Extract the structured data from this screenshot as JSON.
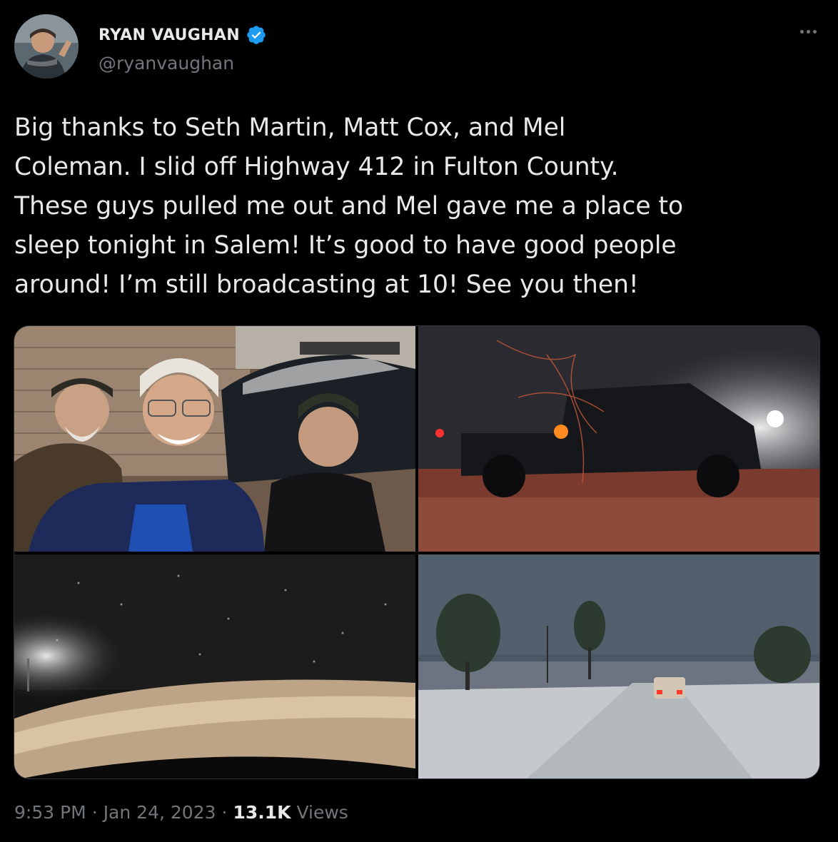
{
  "author": {
    "display_name": "RYAN VAUGHAN",
    "handle": "@ryanvaughan",
    "verified": true,
    "verified_color": "#1d9bf0"
  },
  "more_icon": "more-horizontal-icon",
  "tweet": {
    "lines": [
      "Big thanks to Seth Martin, Matt Cox, and Mel",
      "Coleman. I slid off Highway 412 in Fulton County.",
      "These guys pulled me out and Mel gave me a place to",
      "sleep tonight in Salem! It’s good to have good people",
      "around! I’m still broadcasting at 10! See you then!"
    ]
  },
  "meta": {
    "time": "9:53 PM",
    "separator": "·",
    "date": "Jan 24, 2023",
    "views_count": "13.1K",
    "views_label": "Views"
  },
  "colors": {
    "background": "#000000",
    "text": "#e7e9ea",
    "secondary_text": "#71767b",
    "accent": "#1d9bf0"
  }
}
